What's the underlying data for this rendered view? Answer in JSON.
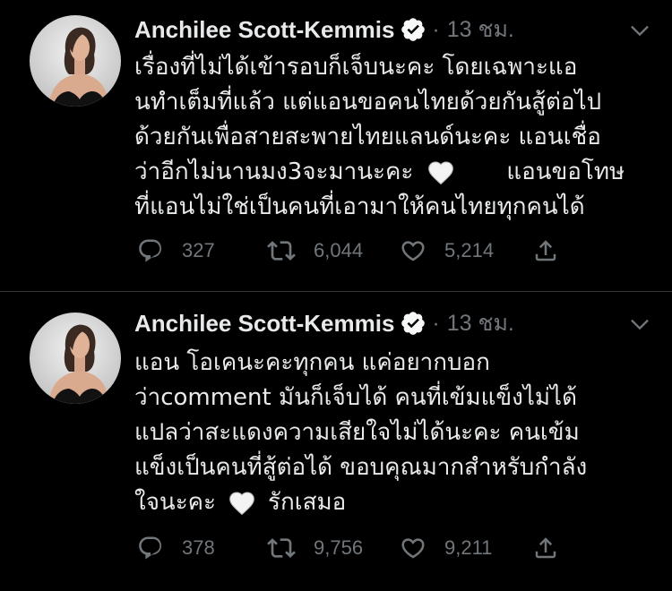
{
  "theme": {
    "background": "#000000",
    "text": "#e7e9ea",
    "muted": "#71767b",
    "divider": "#2f3336",
    "verified_badge": "#f7f9f9"
  },
  "icons": {
    "verified": "verified-badge-icon",
    "more": "chevron-down-icon",
    "reply": "reply-icon",
    "retweet": "retweet-icon",
    "like": "heart-outline-icon",
    "share": "share-icon",
    "emoji": "white-heart-icon"
  },
  "tweets": [
    {
      "author": "Anchilee Scott-Kemmis",
      "separator": "·",
      "time": "13 ชม.",
      "lines": [
        {
          "text": "เรื่องที่ไม่ได้เข้ารอบก็เจ็บนะคะ โดยเฉพาะแอ"
        },
        {
          "text": "นทำเต็มที่แล้ว แต่แอนขอคนไทยด้วยกันสู้ต่อไป"
        },
        {
          "text": "ด้วยกันเพื่อสายสะพายไทยแลนด์นะคะ แอนเชื่อ"
        },
        {
          "text": "ว่าอีกไม่นานมง3จะมานะคะ",
          "emoji": "white-heart-icon",
          "after": "แอนขอโทษ"
        },
        {
          "text": "ที่แอนไม่ใช่เป็นคนที่เอามาให้คนไทยทุกคนได้"
        }
      ],
      "stats": {
        "replies": "327",
        "retweets": "6,044",
        "likes": "5,214"
      }
    },
    {
      "author": "Anchilee Scott-Kemmis",
      "separator": "·",
      "time": "13 ชม.",
      "lines": [
        {
          "text": "แอน โอเคนะคะทุกคน แค่อยากบอก"
        },
        {
          "text": "ว่าcomment มันก็เจ็บได้ คนที่เข้มแข็งไม่ได้"
        },
        {
          "text": "แปลว่าสะแดงความเสียใจไม่ได้นะคะ คนเข้ม"
        },
        {
          "text": "แข็งเป็นคนที่สู้ต่อได้ ขอบคุณมากสำหรับกำลัง"
        },
        {
          "text": "ใจนะคะ",
          "emoji": "white-heart-icon",
          "after": "รักเสมอ"
        }
      ],
      "stats": {
        "replies": "378",
        "retweets": "9,756",
        "likes": "9,211"
      }
    }
  ]
}
